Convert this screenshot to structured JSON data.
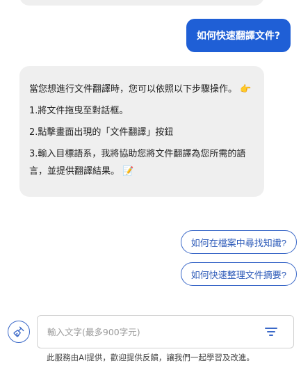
{
  "chat": {
    "user_message": "如何快速翻譯文件?",
    "bot_reply": {
      "intro": "當您想進行文件翻譯時，您可以依照以下步驟操作。",
      "intro_emoji": "👉",
      "step1": "1.將文件拖曳至對話框。",
      "step2": "2.點擊畫面出現的「文件翻譯」按鈕",
      "step3": "3.輸入目標語系，我將協助您將文件翻譯為您所需的語言，並提供翻譯結果。",
      "step3_emoji": "📝"
    }
  },
  "suggestions": [
    {
      "label": "如何在檔案中尋找知識?"
    },
    {
      "label": "如何快速整理文件摘要?"
    }
  ],
  "composer": {
    "placeholder": "輸入文字(最多900字元)",
    "clear_icon": "brush-icon",
    "filter_icon": "filter-icon"
  },
  "footer": {
    "note": "此服務由AI提供，歡迎提供反饋，讓我們一起學習及改進。"
  },
  "colors": {
    "accent": "#1f5fd6",
    "bubble_bg": "#efefef",
    "suggestion_border": "#3a68c8"
  }
}
